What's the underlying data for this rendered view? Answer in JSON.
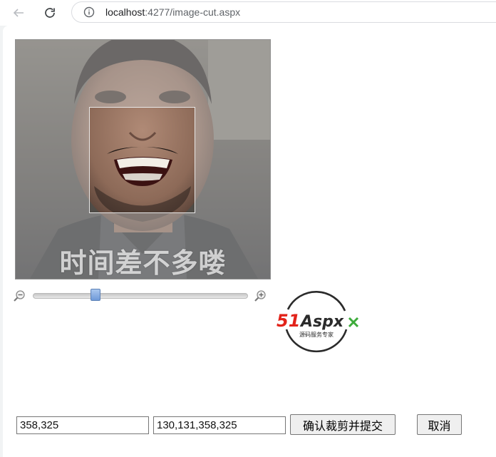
{
  "browser": {
    "url_host": "localhost",
    "url_rest": ":4277/image-cut.aspx"
  },
  "crop": {
    "caption": "时间差不多喽"
  },
  "zoom": {
    "level": 0.28
  },
  "logo": {
    "brand_51": "51",
    "brand_aspx": "Aspx",
    "tagline": "源码服务专家"
  },
  "form": {
    "size_value": "358,325",
    "coords_value": "130,131,358,325",
    "submit_label": "确认裁剪并提交",
    "cancel_label": "取消"
  },
  "colors": {
    "logo_red": "#e2231a",
    "logo_green": "#3cab3a",
    "slider_thumb": "#7aa3dd"
  }
}
